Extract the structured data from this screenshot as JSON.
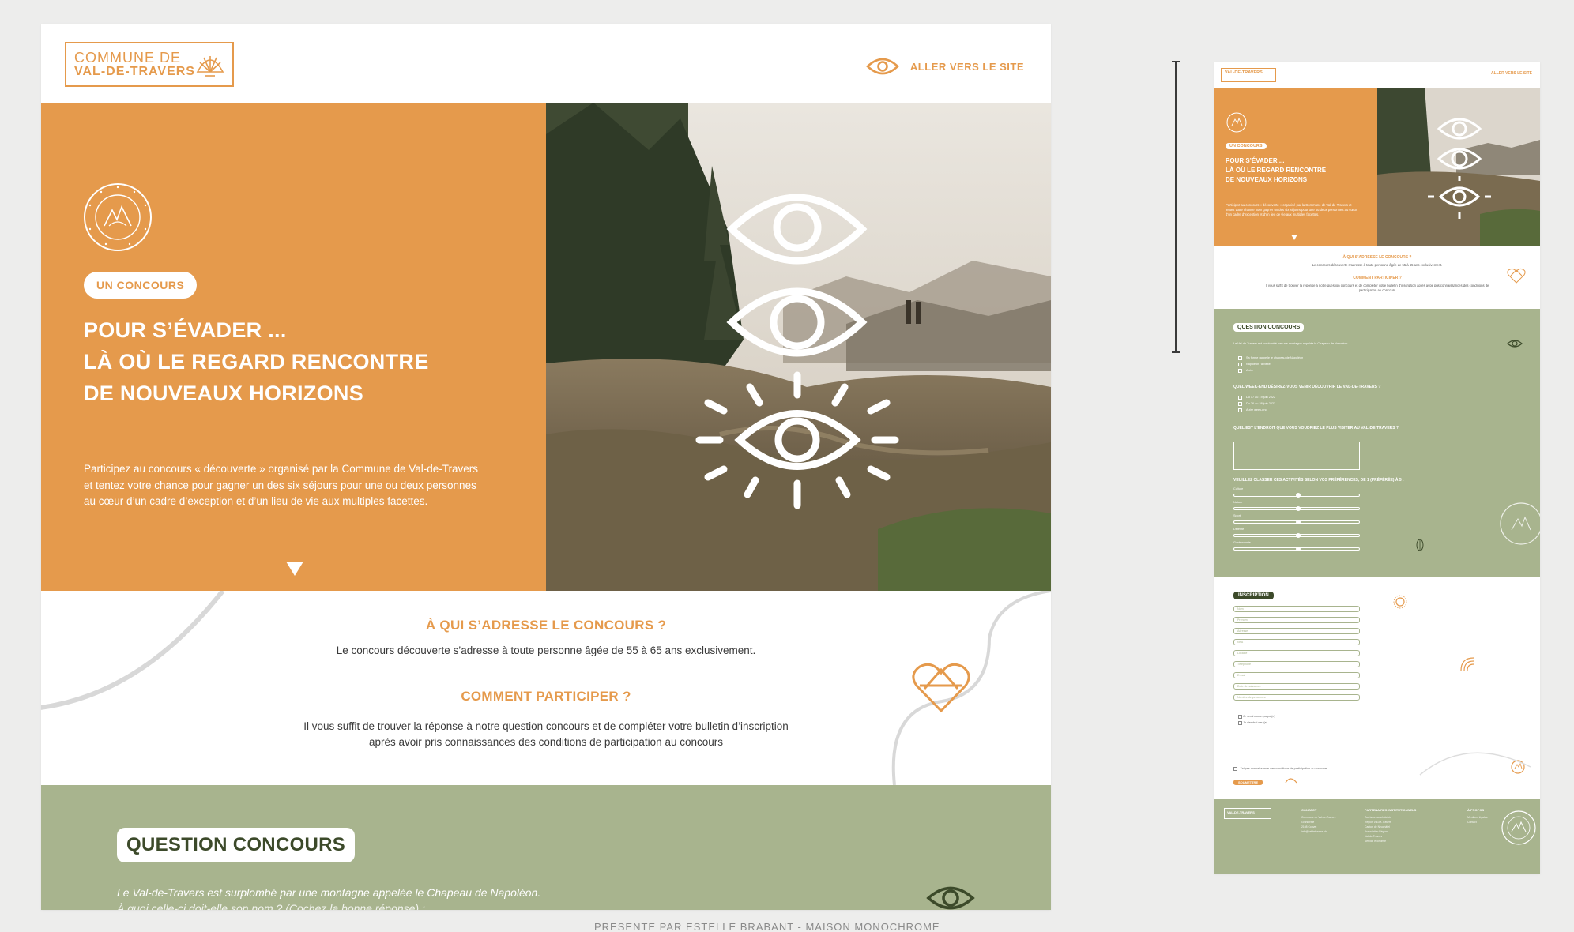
{
  "main": {
    "logo": {
      "line1": "COMMUNE DE",
      "line2": "VAL-DE-TRAVERS"
    },
    "nav": {
      "link_label": "ALLER VERS LE SITE",
      "icon": "eye-icon"
    },
    "hero": {
      "badge": "UN CONCOURS",
      "title_lines": [
        "POUR S’ÉVADER ...",
        "LÀ OÙ LE REGARD RENCONTRE",
        "DE NOUVEAUX HORIZONS"
      ],
      "text": "Participez au concours « découverte » organisé par la Commune de Val-de-Travers et tentez votre chance pour gagner un des six séjours pour une ou deux personnes au cœur d’un cadre d’exception et d’un lieu de vie aux multiples facettes.",
      "seal_text": "QUALITÉ DE VIE · VAL-DE-TRAVERS",
      "scroll_icon": "triangle-down-icon"
    },
    "who": {
      "heading": "À QUI S’ADRESSE LE CONCOURS ?",
      "text": "Le concours découverte s’adresse à toute personne âgée de 55 à 65 ans exclusivement.",
      "heading2": "COMMENT PARTICIPER ?",
      "text2_line1": "Il vous suffit de trouver la réponse à notre question concours et de compléter votre bulletin d’inscription",
      "text2_line2": "après avoir pris connaissances des conditions de participation au concours"
    },
    "question": {
      "badge": "QUESTION CONCOURS",
      "text_line1": "Le Val-de-Travers est surplombé par une montagne appelée le Chapeau de Napoléon.",
      "text_line2": "À quoi celle-ci doit-elle son nom ? (Cochez la bonne réponse) :"
    },
    "caption": "PRÉSENTÉ PAR ESTELLE BRABANT - MAISON MONOCHROME"
  },
  "mini": {
    "logo": "VAL-DE-TRAVERS",
    "nav": "ALLER VERS LE SITE",
    "badge": "UN CONCOURS",
    "title_lines": [
      "POUR S’ÉVADER ...",
      "LÀ OÙ LE REGARD RENCONTRE",
      "DE NOUVEAUX HORIZONS"
    ],
    "text": "Participez au concours « découverte » organisé par la Commune de Val-de-Travers et tentez votre chance pour gagner un des six séjours pour une ou deux personnes au cœur d’un cadre d’exception et d’un lieu de vie aux multiples facettes.",
    "who_heading": "À QUI S’ADRESSE LE CONCOURS ?",
    "who_text": "Le concours découverte s’adresse à toute personne âgée de 55 à 65 ans exclusivement.",
    "how_heading": "COMMENT PARTICIPER ?",
    "how_text": "Il vous suffit de trouver la réponse à notre question concours et de compléter votre bulletin d’inscription après avoir pris connaissances des conditions de participation au concours",
    "q_badge": "QUESTION CONCOURS",
    "q_intro": "Le Val-de-Travers est surplombé par une montagne appelée le Chapeau de Napoléon.",
    "q_options": [
      "Sa forme rappelle le chapeau de Napoléon",
      "Napoléon l'a visité",
      "Autre"
    ],
    "q2_label": "QUEL WEEK-END DÉSIREZ-VOUS VENIR DÉCOUVRIR LE VAL-DE-TRAVERS ?",
    "q2_options": [
      "Du 17 au 19 juin 2022",
      "Du 26 au 28 juin 2022",
      "Autre week-end"
    ],
    "q3_label": "QUEL EST L'ENDROIT QUE VOUS VOUDRIEZ LE PLUS VISITER AU VAL-DE-TRAVERS ?",
    "q4_label": "VEUILLEZ CLASSER CES ACTIVITÉS SELON VOS PRÉFÉRENCES, DE 1 (PRÉFÉRÉE) À 5 :",
    "q4_items": [
      "Culture",
      "Nature",
      "Sport",
      "Détente",
      "Gastronomie"
    ],
    "ins_badge": "INSCRIPTION",
    "ins_fields": [
      "Nom",
      "Prénom",
      "Adresse",
      "NPA",
      "Localité",
      "Téléphone",
      "E-mail",
      "Date de naissance",
      "Nombre de personnes"
    ],
    "ins_checks": [
      "Je serai accompagné(e)",
      "Je viendrai seul(e)"
    ],
    "ins_terms": "J'ai pris connaissance des conditions de participation au concours",
    "ins_submit": "SOUMETTRE",
    "footer": {
      "logo": "VAL-DE-TRAVERS",
      "col1_title": "CONTACT",
      "col1_items": [
        "Commune de Val-de-Travers",
        "Grand'Rue",
        "2108 Couvet",
        "info@valdetravers.ch"
      ],
      "col2_title": "PARTENAIRES INSTITUTIONNELS",
      "col2_items": [
        "Tourisme neuchâtelois",
        "Région Val-de-Travers",
        "Canton de Neuchâtel",
        "Association Région",
        "Val-de-Travers",
        "Service économie"
      ],
      "col3_title": "À PROPOS",
      "col3_items": [
        "Mentions légales",
        "Contact"
      ]
    }
  },
  "colors": {
    "orange": "#e59a4c",
    "olive": "#a8b48e",
    "dark_olive": "#3c4a2a",
    "bg": "#ededec"
  }
}
